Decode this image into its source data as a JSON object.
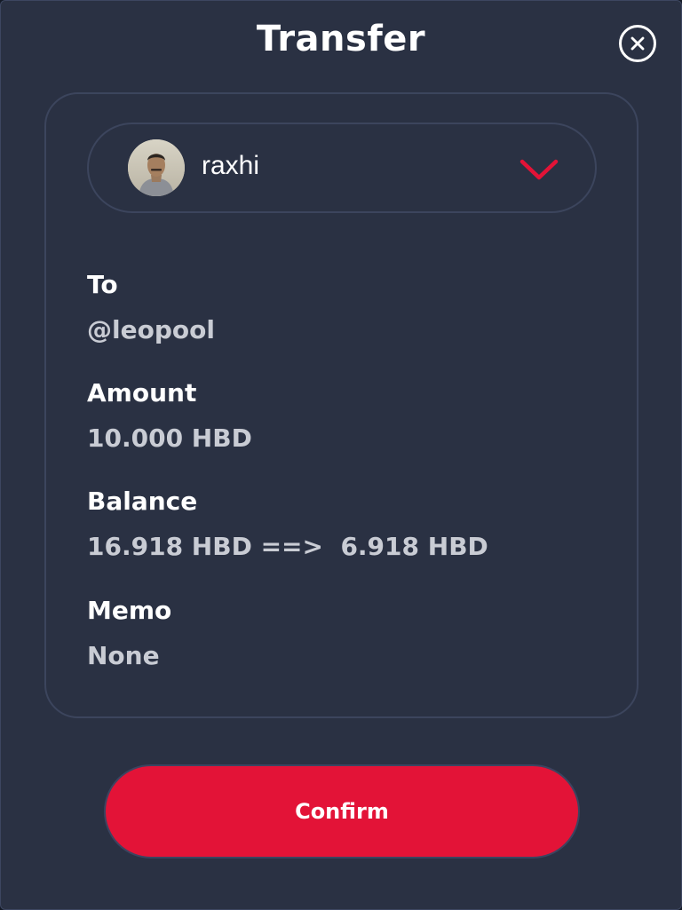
{
  "dialog": {
    "title": "Transfer",
    "close_icon": "close-icon"
  },
  "account": {
    "username": "raxhi",
    "avatar_icon": "avatar",
    "dropdown_icon": "chevron-down-icon",
    "accent_color": "#e31337"
  },
  "fields": {
    "to_label": "To",
    "to_value": "@leopool",
    "amount_label": "Amount",
    "amount_value": "10.000 HBD",
    "balance_label": "Balance",
    "balance_value": "16.918 HBD ==>  6.918 HBD",
    "memo_label": "Memo",
    "memo_value": "None"
  },
  "actions": {
    "confirm_label": "Confirm",
    "confirm_color": "#e31337"
  }
}
